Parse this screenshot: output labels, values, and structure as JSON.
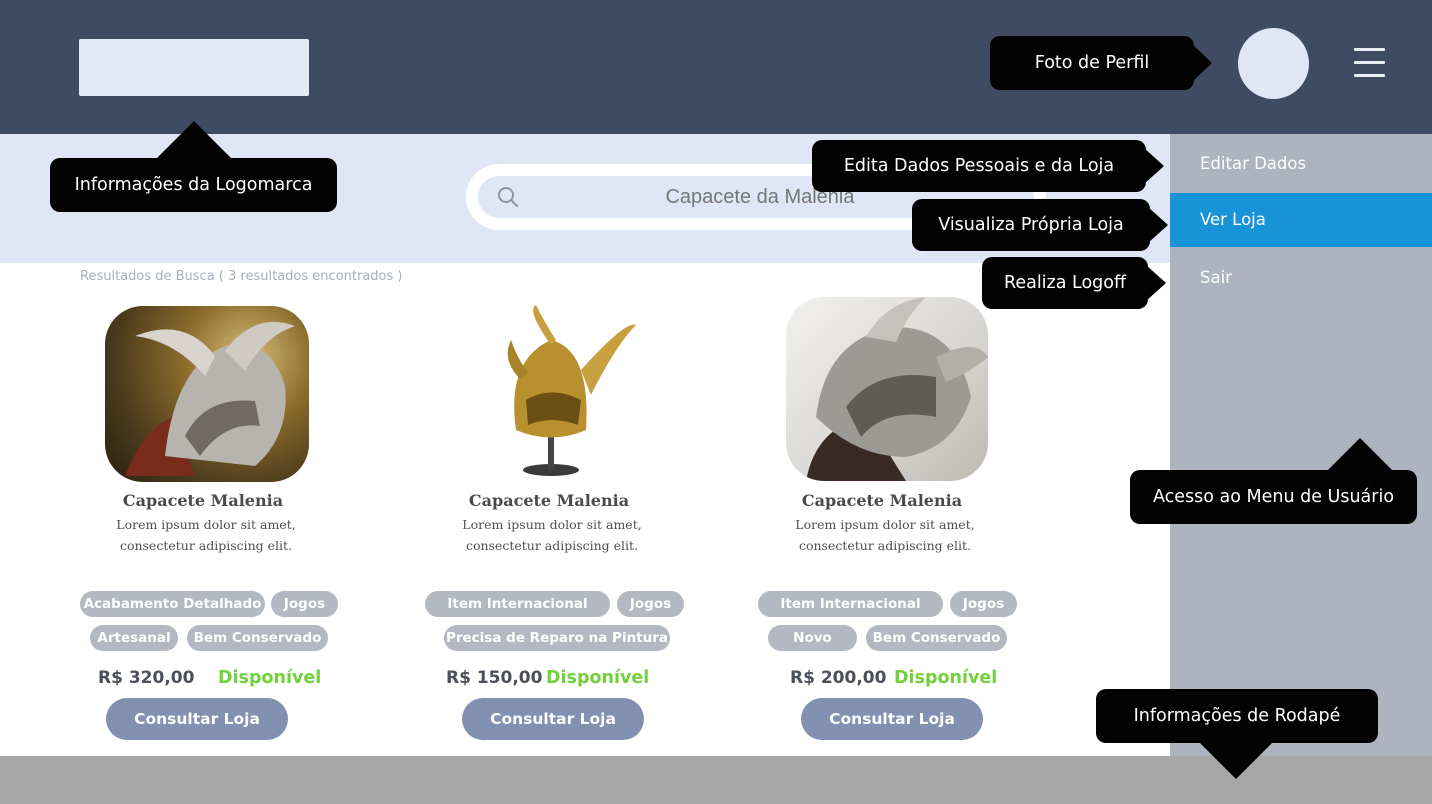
{
  "header": {
    "logo_label": "",
    "menu_icon": "hamburger-menu-icon"
  },
  "search": {
    "placeholder": "Capacete da Malenia",
    "icon": "search-icon"
  },
  "results": {
    "summary": "Resultados de Busca ( 3 resultados encontrados )"
  },
  "products": [
    {
      "title": "Capacete Malenia",
      "desc_line1": "Lorem ipsum dolor sit amet,",
      "desc_line2": "consectetur adipiscing elit.",
      "tags": [
        "Acabamento Detalhado",
        "Jogos",
        "Artesanal",
        "Bem Conservado"
      ],
      "price": "R$ 320,00",
      "status": "Disponível",
      "button": "Consultar Loja"
    },
    {
      "title": "Capacete Malenia",
      "desc_line1": "Lorem ipsum dolor sit amet,",
      "desc_line2": "consectetur adipiscing elit.",
      "tags": [
        "Item Internacional",
        "Jogos",
        "Precisa de Reparo na Pintura"
      ],
      "price": "R$ 150,00",
      "status": "Disponível",
      "button": "Consultar Loja"
    },
    {
      "title": "Capacete Malenia",
      "desc_line1": "Lorem ipsum dolor sit amet,",
      "desc_line2": "consectetur adipiscing elit.",
      "tags": [
        "Item Internacional",
        "Jogos",
        "Novo",
        "Bem Conservado"
      ],
      "price": "R$ 200,00",
      "status": "Disponível",
      "button": "Consultar Loja"
    }
  ],
  "side_menu": {
    "items": [
      {
        "label": "Editar Dados",
        "active": false
      },
      {
        "label": "Ver Loja",
        "active": true
      },
      {
        "label": "Sair",
        "active": false
      }
    ]
  },
  "annotations": {
    "profile_photo": "Foto de Perfil",
    "logo_info": "Informações da Logomarca",
    "edit_data": "Edita Dados Pessoais e da Loja",
    "view_store": "Visualiza Própria Loja",
    "logoff": "Realiza Logoff",
    "user_menu": "Acesso ao Menu de Usuário",
    "footer_info": "Informações de Rodapé"
  },
  "colors": {
    "header_bg": "#3f4a63",
    "search_band_bg": "#dfe7f7",
    "menu_bg": "#aeb3c0",
    "menu_active": "#1993d7",
    "tag_bg": "#b3b8c3",
    "button_bg": "#8291b1",
    "available_green": "#72d13c",
    "footer_bg": "#a7a7a7",
    "callout_bg": "#020202"
  }
}
